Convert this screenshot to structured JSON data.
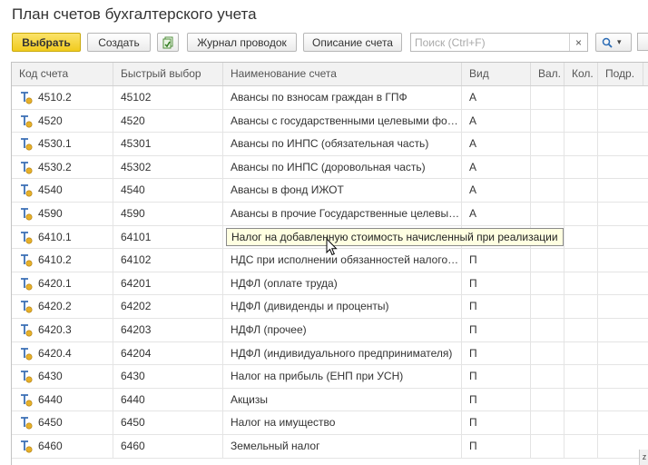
{
  "title": "План счетов бухгалтерского учета",
  "toolbar": {
    "select_label": "Выбрать",
    "create_label": "Создать",
    "journal_label": "Журнал проводок",
    "description_label": "Описание счета",
    "search_placeholder": "Поиск (Ctrl+F)",
    "clear_glyph": "×",
    "search_glyph": "🔍",
    "dropdown_glyph": "▾"
  },
  "columns": {
    "code": "Код счета",
    "quick": "Быстрый выбор",
    "name": "Наименование счета",
    "kind": "Вид",
    "cur": "Вал.",
    "qty": "Кол.",
    "sub": "Подр."
  },
  "rows": [
    {
      "code": "4510.2",
      "quick": "45102",
      "name": "Авансы по взносам граждан в ГПФ",
      "kind": "А"
    },
    {
      "code": "4520",
      "quick": "4520",
      "name": "Авансы с государственными целевыми фон...",
      "kind": "А"
    },
    {
      "code": "4530.1",
      "quick": "45301",
      "name": "Авансы по ИНПС (обязательная часть)",
      "kind": "А"
    },
    {
      "code": "4530.2",
      "quick": "45302",
      "name": "Авансы по ИНПС (доровольная часть)",
      "kind": "А"
    },
    {
      "code": "4540",
      "quick": "4540",
      "name": "Авансы в фонд ИЖОТ",
      "kind": "А"
    },
    {
      "code": "4590",
      "quick": "4590",
      "name": "Авансы в прочие Государственные целевые...",
      "kind": "А"
    },
    {
      "code": "6410.1",
      "quick": "64101",
      "name": "Налог на добавленную стоимость начисленный при реализации",
      "kind": ""
    },
    {
      "code": "6410.2",
      "quick": "64102",
      "name": "НДС при исполнении обязанностей налогов...",
      "kind": "П"
    },
    {
      "code": "6420.1",
      "quick": "64201",
      "name": "НДФЛ (оплате труда)",
      "kind": "П"
    },
    {
      "code": "6420.2",
      "quick": "64202",
      "name": "НДФЛ (дивиденды и проценты)",
      "kind": "П"
    },
    {
      "code": "6420.3",
      "quick": "64203",
      "name": "НДФЛ (прочее)",
      "kind": "П"
    },
    {
      "code": "6420.4",
      "quick": "64204",
      "name": "НДФЛ (индивидуального предпринимателя)",
      "kind": "П"
    },
    {
      "code": "6430",
      "quick": "6430",
      "name": "Налог на прибыль (ЕНП при УСН)",
      "kind": "П"
    },
    {
      "code": "6440",
      "quick": "6440",
      "name": "Акцизы",
      "kind": "П"
    },
    {
      "code": "6450",
      "quick": "6450",
      "name": "Налог на имущество",
      "kind": "П"
    },
    {
      "code": "6460",
      "quick": "6460",
      "name": "Земельный налог",
      "kind": "П"
    }
  ],
  "tooltip": "Налог на добавленную стоимость начисленный при реализации",
  "corner_fragment": "z",
  "colors": {
    "primary_button": "#f1cb1e",
    "header_bg": "#f2f2f2",
    "tooltip_bg": "#ffffe1",
    "account_icon_blue": "#3a6fb5",
    "account_icon_gold": "#e6b12a"
  }
}
